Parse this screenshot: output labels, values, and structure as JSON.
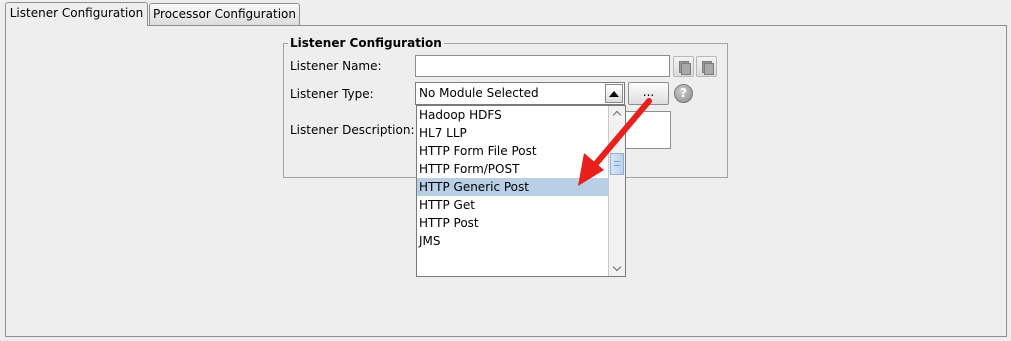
{
  "tabs": [
    {
      "label": "Listener Configuration",
      "active": true
    },
    {
      "label": "Processor Configuration",
      "active": false
    }
  ],
  "group": {
    "title": "Listener Configuration",
    "name_label": "Listener Name:",
    "name_value": "",
    "type_label": "Listener Type:",
    "type_selected": "No Module Selected",
    "browse_label": "...",
    "help_glyph": "?",
    "description_label": "Listener Description:",
    "description_value": ""
  },
  "dropdown": {
    "items": [
      "Hadoop HDFS",
      "HL7 LLP",
      "HTTP Form File Post",
      "HTTP Form/POST",
      "HTTP Generic Post",
      "HTTP Get",
      "HTTP Post",
      "JMS"
    ],
    "highlighted": "HTTP Generic Post"
  },
  "annotation": {
    "color": "#e8201c",
    "target": "HTTP Generic Post"
  },
  "colors": {
    "selection": "#b8cfe5",
    "panel": "#eeeeee"
  }
}
